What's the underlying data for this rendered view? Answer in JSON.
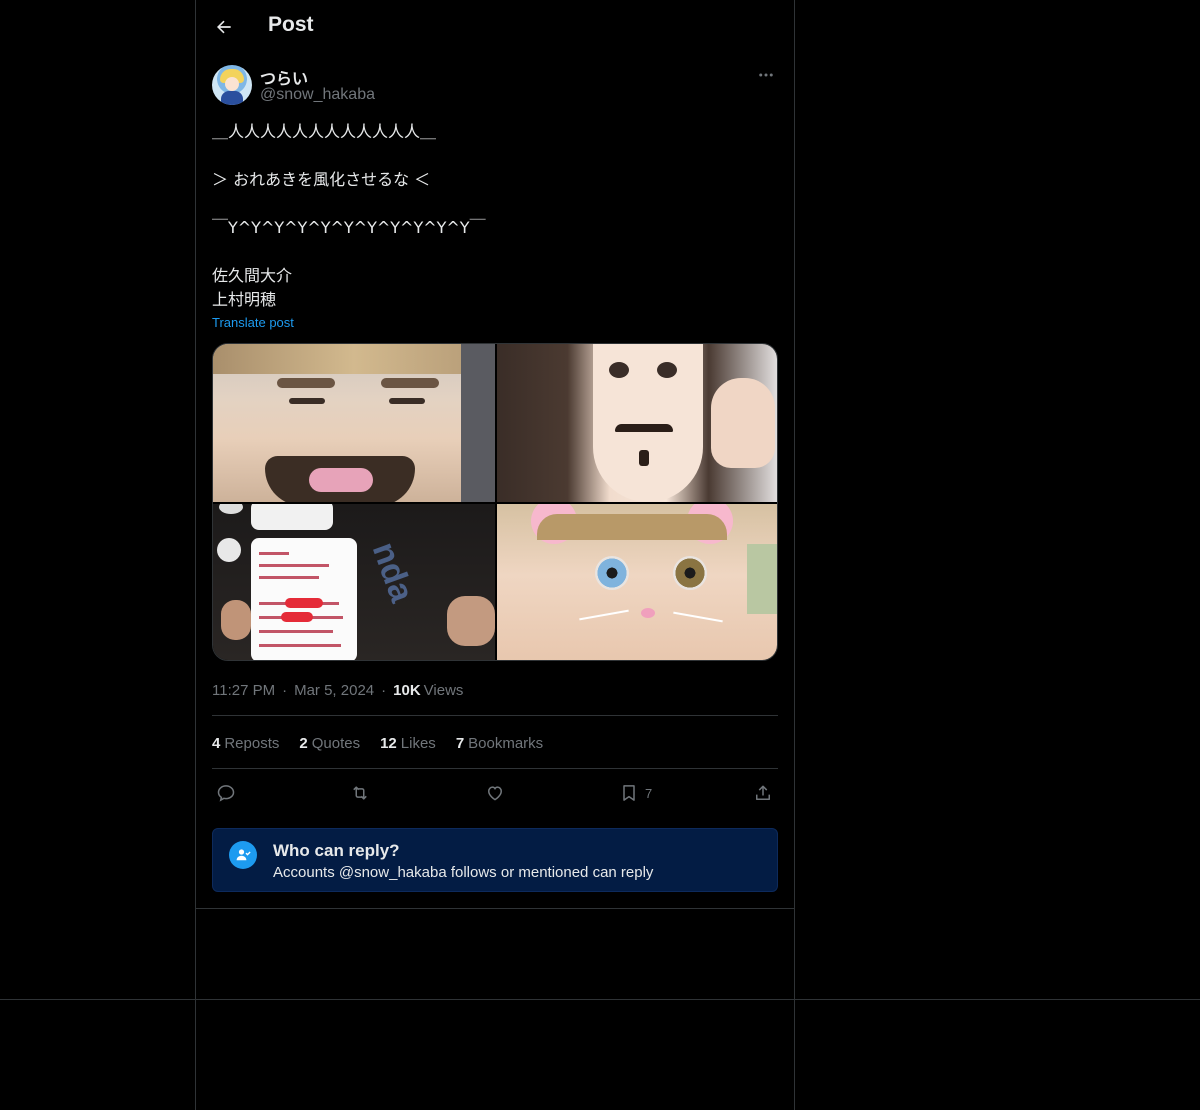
{
  "header": {
    "title": "Post"
  },
  "author": {
    "display_name": "つらい",
    "handle": "@snow_hakaba"
  },
  "post": {
    "lines": [
      "＿人人人人人人人人人人人人＿",
      "",
      "＞ おれあきを風化させるな ＜",
      "",
      "￣Y^Y^Y^Y^Y^Y^Y^Y^Y^Y^Y￣",
      "",
      "佐久間大介",
      "上村明穂"
    ],
    "translate_label": "Translate post",
    "time": "11:27 PM",
    "date": "Mar 5, 2024",
    "views_count": "10K",
    "views_label": "Views"
  },
  "media": {
    "watermark": "nda"
  },
  "stats": {
    "reposts_count": "4",
    "reposts_label": "Reposts",
    "quotes_count": "2",
    "quotes_label": "Quotes",
    "likes_count": "12",
    "likes_label": "Likes",
    "bookmarks_count": "7",
    "bookmarks_label": "Bookmarks"
  },
  "actions": {
    "bookmark_count": "7"
  },
  "reply_restriction": {
    "title": "Who can reply?",
    "subtitle": "Accounts @snow_hakaba follows or mentioned can reply"
  },
  "colors": {
    "background": "#000000",
    "text": "#e7e9ea",
    "muted": "#71767b",
    "accent": "#1d9bf0",
    "reply_box": "#031c44"
  },
  "icons": [
    "back-arrow-icon",
    "more-icon",
    "reply-icon",
    "repost-icon",
    "like-icon",
    "bookmark-icon",
    "share-icon",
    "person-check-icon"
  ]
}
